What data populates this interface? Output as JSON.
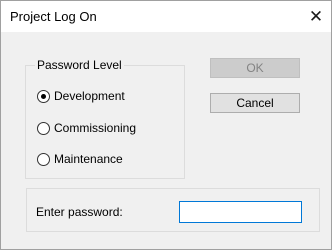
{
  "window": {
    "title": "Project Log On",
    "close_glyph": "✕"
  },
  "password_level": {
    "legend": "Password Level",
    "options": [
      {
        "label": "Development",
        "selected": true
      },
      {
        "label": "Commissioning",
        "selected": false
      },
      {
        "label": "Maintenance",
        "selected": false
      }
    ]
  },
  "buttons": {
    "ok_label": "OK",
    "ok_enabled": false,
    "cancel_label": "Cancel"
  },
  "password": {
    "label": "Enter password:",
    "value": ""
  },
  "colors": {
    "dialog_bg": "#f0f0f0",
    "titlebar_bg": "#ffffff",
    "input_focus_border": "#0078d7",
    "disabled_text": "#838383"
  },
  "icons": {
    "close": "close-icon"
  }
}
